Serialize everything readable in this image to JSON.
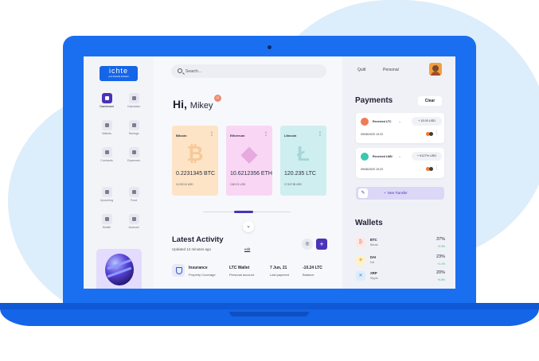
{
  "sidebar": {
    "logo_text": "ichte",
    "logo_tagline": "your financial assistant",
    "items": [
      {
        "label": "Dashboard",
        "active": true
      },
      {
        "label": "Calculator"
      },
      {
        "label": "Wallets"
      },
      {
        "label": "Savings"
      },
      {
        "label": "Contracts"
      },
      {
        "label": "Expenses"
      },
      {
        "label": "Upcoming"
      },
      {
        "label": "Food"
      },
      {
        "label": "Health"
      },
      {
        "label": "Account"
      }
    ]
  },
  "search": {
    "placeholder": "Search..."
  },
  "greeting": {
    "hi": "Hi,",
    "name": "Mikey",
    "notification_count": "21"
  },
  "cards": [
    {
      "name": "Bitcoin",
      "symbol": "₿",
      "amount": "0.2231345 BTC",
      "usd": "11,032.24 USD",
      "bg": "#fde4c6",
      "fg": "#e89a45"
    },
    {
      "name": "Ethereum",
      "symbol": "◆",
      "amount": "10.6212356 ETH",
      "usd": "1343.21 USD",
      "bg": "#f9d6f4",
      "fg": "#c45bbb"
    },
    {
      "name": "Litecoin",
      "symbol": "Ł",
      "amount": "120.235 LTC",
      "usd": "17,947.98 USD",
      "bg": "#cfeef0",
      "fg": "#58a9b4"
    }
  ],
  "activity": {
    "title": "Latest Activity",
    "updated": "Updated 12 minutes ago",
    "edit": "edit",
    "row": {
      "c1": {
        "a": "Insurance",
        "b": "Property Coverage"
      },
      "c2": {
        "a": "LTC Wallet",
        "b": "Personal account"
      },
      "c3": {
        "a": "7 Jun, 21",
        "b": "Last payment"
      },
      "c4": {
        "a": "-10.24 LTC",
        "b": "Balance"
      }
    }
  },
  "header_tabs": [
    "Quilt",
    "Personal"
  ],
  "payments": {
    "title": "Payments",
    "clear": "Clear",
    "items": [
      {
        "label": "Received LTC",
        "amount": "+ 15.00 USD",
        "date": "09/08/2020 19:23",
        "color": "#f07b55"
      },
      {
        "label": "Received LMN",
        "amount": "+ 9127% USD",
        "date": "09/08/2020 19:23",
        "color": "#3dc6b0"
      }
    ],
    "new_transfer": "New Transfer"
  },
  "wallets": {
    "title": "Wallets",
    "items": [
      {
        "symbol": "BTC",
        "name": "Bitcoin",
        "percent": "37%",
        "change": "+2.3%",
        "icon": "₿",
        "bg": "#fde8e3",
        "fg": "#f07b55"
      },
      {
        "symbol": "DAI",
        "name": "Dai",
        "percent": "23%",
        "change": "+1.1%",
        "icon": "◈",
        "bg": "#fdf1cf",
        "fg": "#e5b12c"
      },
      {
        "symbol": "XRP",
        "name": "Ripple",
        "percent": "20%",
        "change": "+0.8%",
        "icon": "✕",
        "bg": "#dcecfb",
        "fg": "#3a8de0"
      }
    ]
  }
}
